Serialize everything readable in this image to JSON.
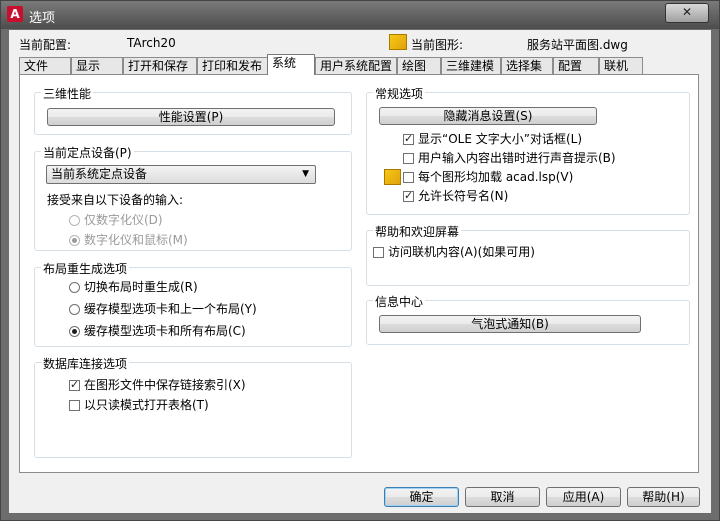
{
  "window": {
    "title": "选项",
    "close": "✕",
    "app_icon_letter": "A"
  },
  "header": {
    "current_profile_label": "当前配置:",
    "current_profile_value": "TArch20",
    "current_drawing_label": "当前图形:",
    "current_drawing_value": "服务站平面图.dwg"
  },
  "tabs": [
    "文件",
    "显示",
    "打开和保存",
    "打印和发布",
    "系统",
    "用户系统配置",
    "绘图",
    "三维建模",
    "选择集",
    "配置",
    "联机"
  ],
  "active_tab": "系统",
  "groups": {
    "perf": {
      "title": "三维性能",
      "button": "性能设置(P)"
    },
    "pointing": {
      "title": "当前定点设备(P)",
      "selected": "当前系统定点设备",
      "accept_label": "接受来自以下设备的输入:",
      "opt_digitizer_only": "仅数字化仪(D)",
      "opt_digitizer_mouse": "数字化仪和鼠标(M)"
    },
    "layout_regen": {
      "title": "布局重生成选项",
      "opt1": "切换布局时重生成(R)",
      "opt2": "缓存模型选项卡和上一个布局(Y)",
      "opt3": "缓存模型选项卡和所有布局(C)"
    },
    "db": {
      "title": "数据库连接选项",
      "opt1": "在图形文件中保存链接索引(X)",
      "opt2": "以只读模式打开表格(T)"
    },
    "general": {
      "title": "常规选项",
      "button": "隐藏消息设置(S)",
      "opt1": "显示“OLE 文字大小”对话框(L)",
      "opt2": "用户输入内容出错时进行声音提示(B)",
      "opt3": "每个图形均加载 acad.lsp(V)",
      "opt4": "允许长符号名(N)"
    },
    "welcome": {
      "title": "帮助和欢迎屏幕",
      "opt1": "访问联机内容(A)(如果可用)"
    },
    "info": {
      "title": "信息中心",
      "button": "气泡式通知(B)"
    }
  },
  "footer": {
    "ok": "确定",
    "cancel": "取消",
    "apply": "应用(A)",
    "help": "帮助(H)"
  }
}
